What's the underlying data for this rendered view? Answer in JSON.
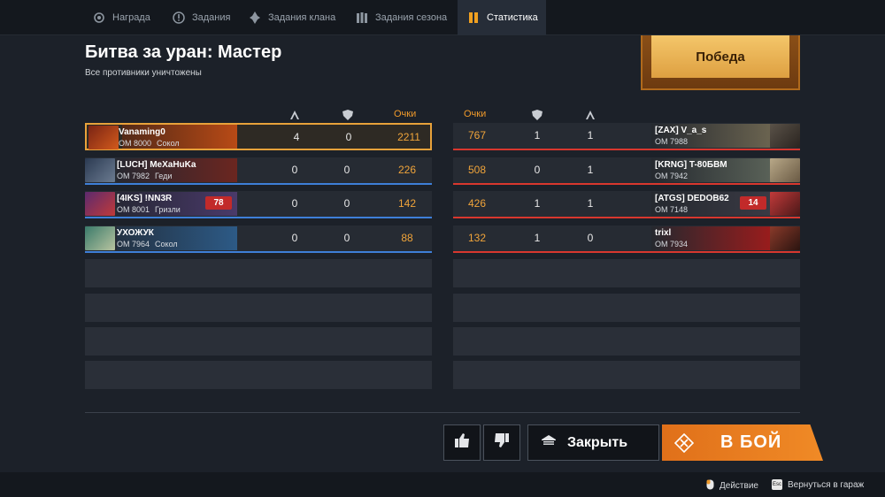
{
  "tabs": [
    {
      "label": "Награда",
      "icon": "gear-award-icon",
      "active": false
    },
    {
      "label": "Задания",
      "icon": "exclamation-gear-icon",
      "active": false
    },
    {
      "label": "Задания клана",
      "icon": "clan-flame-icon",
      "active": false
    },
    {
      "label": "Задания сезона",
      "icon": "season-columns-icon",
      "active": false
    },
    {
      "label": "Статистика",
      "icon": "stats-bookmark-icon",
      "active": true
    }
  ],
  "header": {
    "title": "Битва за уран: Мастер",
    "subtitle": "Все противники уничтожены",
    "result": "Победа"
  },
  "columns": {
    "score": "Очки",
    "kills_icon": "crossed-swords-icon",
    "assists_icon": "shield-icon"
  },
  "allies": [
    {
      "nick": "Vanaming0",
      "om": "ОМ 8000",
      "vehicle": "Сокол",
      "kills": "4",
      "assists": "0",
      "score": "2211",
      "me": true
    },
    {
      "nick": "[LUCH] MeXaHuKa",
      "om": "ОМ 7982",
      "vehicle": "Геди",
      "kills": "0",
      "assists": "0",
      "score": "226"
    },
    {
      "nick": "[4IKS] !NN3R",
      "om": "ОМ 8001",
      "vehicle": "Гризли",
      "badge": "78",
      "kills": "0",
      "assists": "0",
      "score": "142"
    },
    {
      "nick": "УХОЖУК",
      "om": "ОМ 7964",
      "vehicle": "Сокол",
      "kills": "0",
      "assists": "0",
      "score": "88"
    }
  ],
  "enemies": [
    {
      "nick": "[ZAX] V_a_s",
      "om": "ОМ 7988",
      "score": "767",
      "assists": "1",
      "kills": "1"
    },
    {
      "nick": "[KRNG] T-80БВМ",
      "om": "ОМ 7942",
      "score": "508",
      "assists": "0",
      "kills": "1"
    },
    {
      "nick": "[ATGS] DEDOB62",
      "om": "ОМ 7148",
      "badge": "14",
      "score": "426",
      "assists": "1",
      "kills": "1"
    },
    {
      "nick": "trixl",
      "om": "ОМ 7934",
      "score": "132",
      "assists": "1",
      "kills": "0"
    }
  ],
  "buttons": {
    "like_icon": "thumbs-up-icon",
    "dislike_icon": "thumbs-down-icon",
    "close": "Закрыть",
    "battle": "В БОЙ"
  },
  "footer": {
    "action_key": "mouse-icon",
    "action": "Действие",
    "esc_key": "Esc",
    "back": "Вернуться в гараж"
  },
  "colors": {
    "accent": "#f0a020",
    "ally_line": "#3e7fd8",
    "enemy_line": "#d8372e",
    "battle_button": "#f08a26"
  }
}
